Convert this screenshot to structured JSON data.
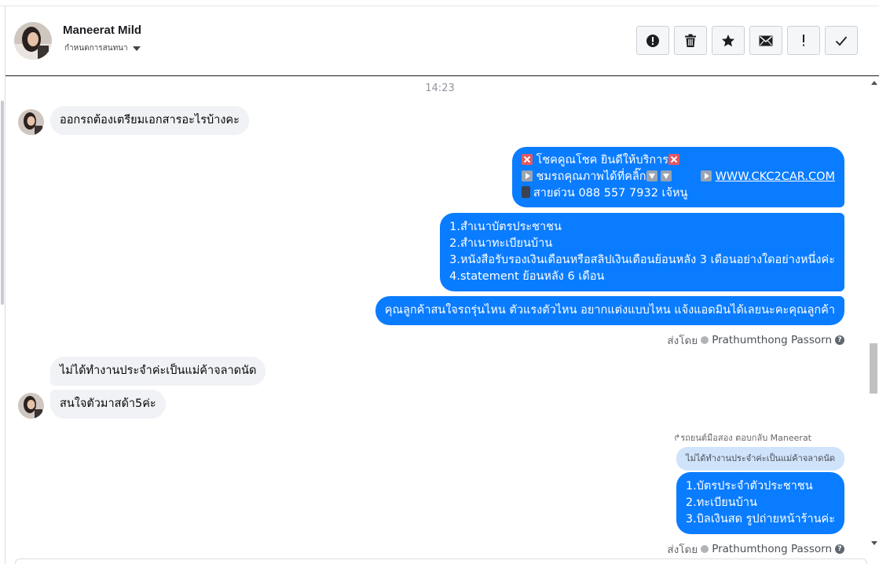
{
  "header": {
    "contact_name": "Maneerat Mild",
    "subtitle": "กำหนดการสนทนา",
    "actions": [
      {
        "name": "alert-button",
        "icon": "exclamation-circle-icon"
      },
      {
        "name": "delete-button",
        "icon": "trash-icon"
      },
      {
        "name": "star-button",
        "icon": "star-icon"
      },
      {
        "name": "mark-unread-button",
        "icon": "envelope-icon"
      },
      {
        "name": "spam-button",
        "icon": "exclamation-icon"
      },
      {
        "name": "done-button",
        "icon": "check-icon"
      }
    ]
  },
  "conversation": {
    "timestamp": "14:23",
    "msg1": "ออกรถต้องเตรียมเอกสารอะไรบ้างคะ",
    "promo": {
      "line1": "โชคคูณโชค ยินดีให้บริการ",
      "line2": "ชมรถคุณภาพได้ที่คลิ๊ก",
      "link": "WWW.CKC2CAR.COM",
      "line3": "สายด่วน 088 557 7932 เจ้หนู"
    },
    "docs": {
      "line1": "1.สำเนาบัตรประชาชน",
      "line2": "2.สำเนาทะเบียนบ้าน",
      "line3": "3.หนังสือรับรองเงินเดือนหรือสลิปเงินเดือนย้อนหลัง 3 เดือนอย่างใดอย่างหนึ่งค่ะ",
      "line4": "4.statement ย้อนหลัง 6 เดือน"
    },
    "ask": "คุณลูกค้าสนใจรถรุ่นไหน ตัวแรงตัวไหน อยากแต่งแบบไหน แจ้งแอดมินได้เลยนะคะคุณลูกค้า",
    "sent_by_label": "ส่งโดย",
    "sent_by_name": "Prathumthong Passorn",
    "msg2": "ไม่ได้ทำงานประจำค่ะเป็นแม่ค้าจลาดนัด",
    "msg3": "สนใจตัวมาสด้า5ค่ะ",
    "reply_label": "รถยนต์มือสอง ตอบกลับ Maneerat",
    "quoted": "ไม่ได้ทำงานประจำค่ะเป็นแม่ค้าจลาดนัด",
    "reply": {
      "line1": "1.บัตรประจำตัวประชาชน",
      "line2": "2.ทะเบียนบ้าน",
      "line3": "3.บิลเงินสด รูปถ่ายหน้าร้านค่ะ"
    }
  },
  "colors": {
    "outgoing_bubble": "#0a7cff",
    "incoming_bubble": "#f0f2f5",
    "quoted_bubble": "#cfe3fb"
  }
}
